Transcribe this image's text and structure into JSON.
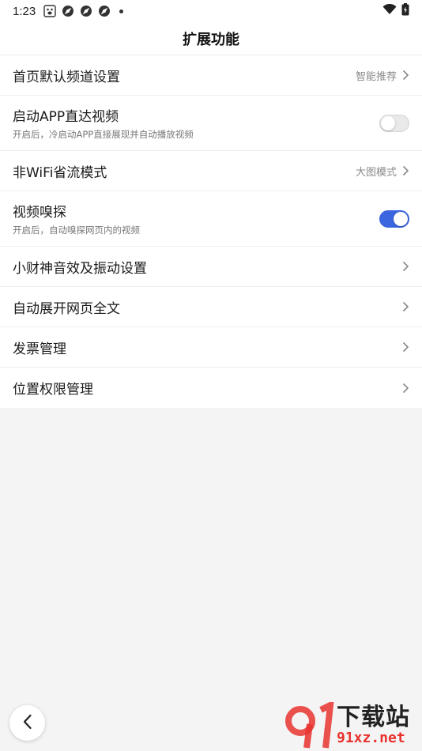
{
  "status_bar": {
    "time": "1:23"
  },
  "header": {
    "title": "扩展功能"
  },
  "settings": [
    {
      "label": "首页默认频道设置",
      "value": "智能推荐"
    },
    {
      "label": "启动APP直达视频",
      "subtitle": "开启后，冷启动APP直接展现并自动播放视频",
      "toggle_on": false
    },
    {
      "label": "非WiFi省流模式",
      "value": "大图模式"
    },
    {
      "label": "视频嗅探",
      "subtitle": "开启后，自动嗅探网页内的视频",
      "toggle_on": true
    },
    {
      "label": "小财神音效及振动设置"
    },
    {
      "label": "自动展开网页全文"
    },
    {
      "label": "发票管理"
    },
    {
      "label": "位置权限管理"
    }
  ],
  "colors": {
    "accent": "#3b66e0",
    "watermark_red": "#e8322e"
  },
  "icons": {
    "back": "chevron-left-icon",
    "row_arrow": "chevron-right-icon"
  },
  "watermark": {
    "cn": "下载站",
    "url": "91xz.net"
  }
}
